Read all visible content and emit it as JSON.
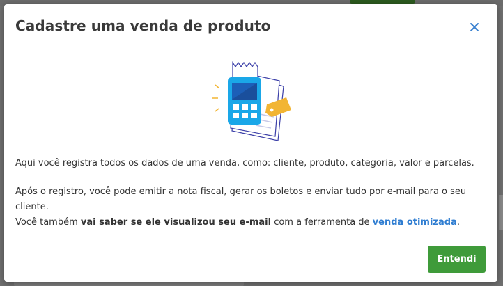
{
  "modal": {
    "title": "Cadastre uma venda de produto",
    "close_icon": "close-icon",
    "illustration": "pos-terminal-receipt-tag-illustration",
    "paragraph1": "Aqui você registra todos os dados de uma venda, como: cliente, produto, categoria, valor e parcelas.",
    "paragraph2_line1": "Após o registro, você pode emitir a nota fiscal, gerar os boletos e enviar tudo por e-mail para o seu cliente.",
    "paragraph2_line2_pre": "Você também ",
    "paragraph2_line2_bold": "vai saber se ele visualizou seu e-mail",
    "paragraph2_line2_mid": " com a ferramenta de ",
    "paragraph2_line2_link": "venda otimizada",
    "paragraph2_line2_post": ".",
    "confirm_label": "Entendi"
  },
  "colors": {
    "accent_blue": "#2f7dd1",
    "button_green": "#3f9b3a",
    "overlay": "#707070"
  }
}
